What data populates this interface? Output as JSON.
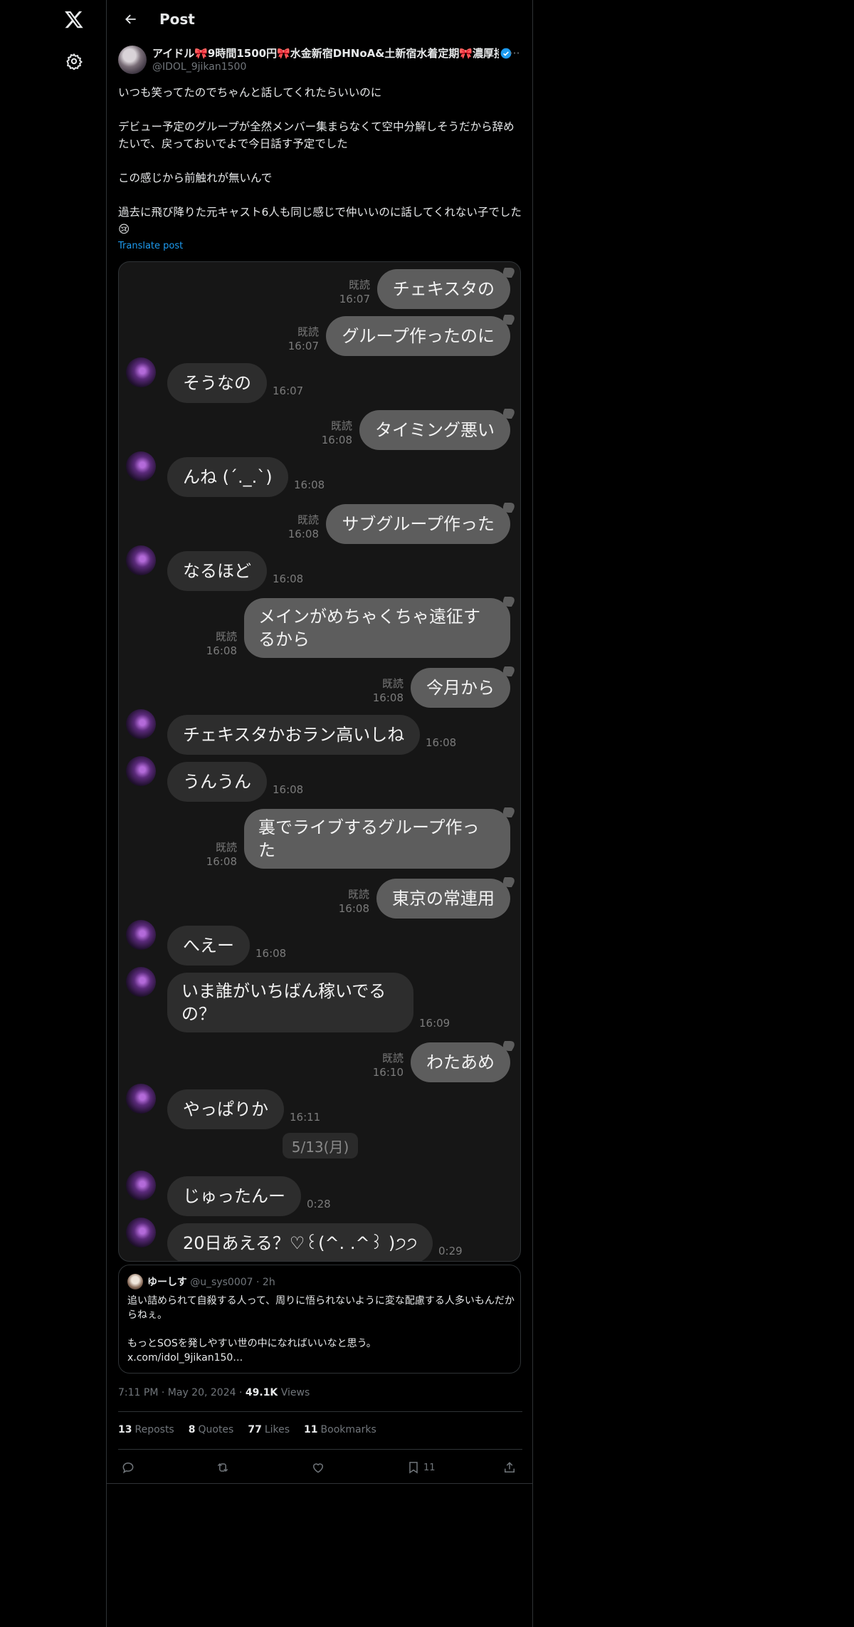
{
  "nav": {
    "logo_icon": "x-logo-icon",
    "settings_icon": "gear-icon"
  },
  "header": {
    "back_icon": "arrow-left-icon",
    "title": "Post"
  },
  "author": {
    "display_name": "アイドル🎀9時間1500円🎀水金新宿DHNoA&土新宿水着定期🎀濃厚接",
    "handle": "@IDOL_9jikan1500",
    "verified": true
  },
  "post": {
    "paragraphs": [
      "いつも笑ってたのでちゃんと話してくれたらいいのに",
      "デビュー予定のグループが全然メンバー集まらなくて空中分解しそうだから辞めたいで、戻っておいでよで今日話す予定でした",
      "この感じから前触れが無いんで",
      "過去に飛び降りた元キャスト6人も同じ感じで仲いいのに話してくれない子でした😢"
    ],
    "translate_label": "Translate post"
  },
  "chat": {
    "messages": [
      {
        "side": "out",
        "text": "チェキスタの",
        "read": "既読",
        "time": "16:07"
      },
      {
        "side": "out",
        "text": "グループ作ったのに",
        "read": "既読",
        "time": "16:07"
      },
      {
        "side": "in",
        "text": "そうなの",
        "time": "16:07"
      },
      {
        "side": "out",
        "text": "タイミング悪い",
        "read": "既読",
        "time": "16:08"
      },
      {
        "side": "in",
        "text": "んね (´._.`)",
        "time": "16:08"
      },
      {
        "side": "out",
        "text": "サブグループ作った",
        "read": "既読",
        "time": "16:08"
      },
      {
        "side": "in",
        "text": "なるほど",
        "time": "16:08"
      },
      {
        "side": "out",
        "text": "メインがめちゃくちゃ遠征するから",
        "read": "既読",
        "time": "16:08"
      },
      {
        "side": "out",
        "text": "今月から",
        "read": "既読",
        "time": "16:08"
      },
      {
        "side": "in",
        "text": "チェキスタかおラン高いしね",
        "time": "16:08"
      },
      {
        "side": "in",
        "text": "うんうん",
        "time": "16:08"
      },
      {
        "side": "out",
        "text": "裏でライブするグループ作った",
        "read": "既読",
        "time": "16:08"
      },
      {
        "side": "out",
        "text": "東京の常連用",
        "read": "既読",
        "time": "16:08"
      },
      {
        "side": "in",
        "text": "へえー",
        "time": "16:08"
      },
      {
        "side": "in",
        "text": "いま誰がいちばん稼いでるの？",
        "time": "16:09"
      },
      {
        "side": "out",
        "text": "わたあめ",
        "read": "既読",
        "time": "16:10"
      },
      {
        "side": "in",
        "text": "やっぱりか",
        "time": "16:11"
      },
      {
        "side": "in",
        "text": "じゅったんー",
        "time": "0:28"
      },
      {
        "side": "in",
        "text": "20日あえる？♡꒰(^. .^꒱ )੭੭",
        "time": "0:29"
      }
    ],
    "date_separator": "5/13(月)"
  },
  "quote": {
    "name": "ゆーしす",
    "handle": "@u_sys0007",
    "age": "· 2h",
    "paragraphs": [
      "追い詰められて自殺する人って、周りに悟られないように変な配慮する人多いもんだからねぇ。",
      "もっとSOSを発しやすい世の中になればいいなと思う。\nx.com/idol_9jikan150…"
    ]
  },
  "meta": {
    "time": "7:11 PM",
    "date": "May 20, 2024",
    "views_count": "49.1K",
    "views_label": "Views"
  },
  "stats": {
    "reposts_count": "13",
    "reposts_label": "Reposts",
    "quotes_count": "8",
    "quotes_label": "Quotes",
    "likes_count": "77",
    "likes_label": "Likes",
    "bookmarks_count": "11",
    "bookmarks_label": "Bookmarks"
  },
  "actions": {
    "bookmark_count": "11"
  },
  "colors": {
    "background": "#000000",
    "accent": "#1d9bf0",
    "bubble_out": "#5d5d5d",
    "bubble_in": "#2d2d2d"
  }
}
